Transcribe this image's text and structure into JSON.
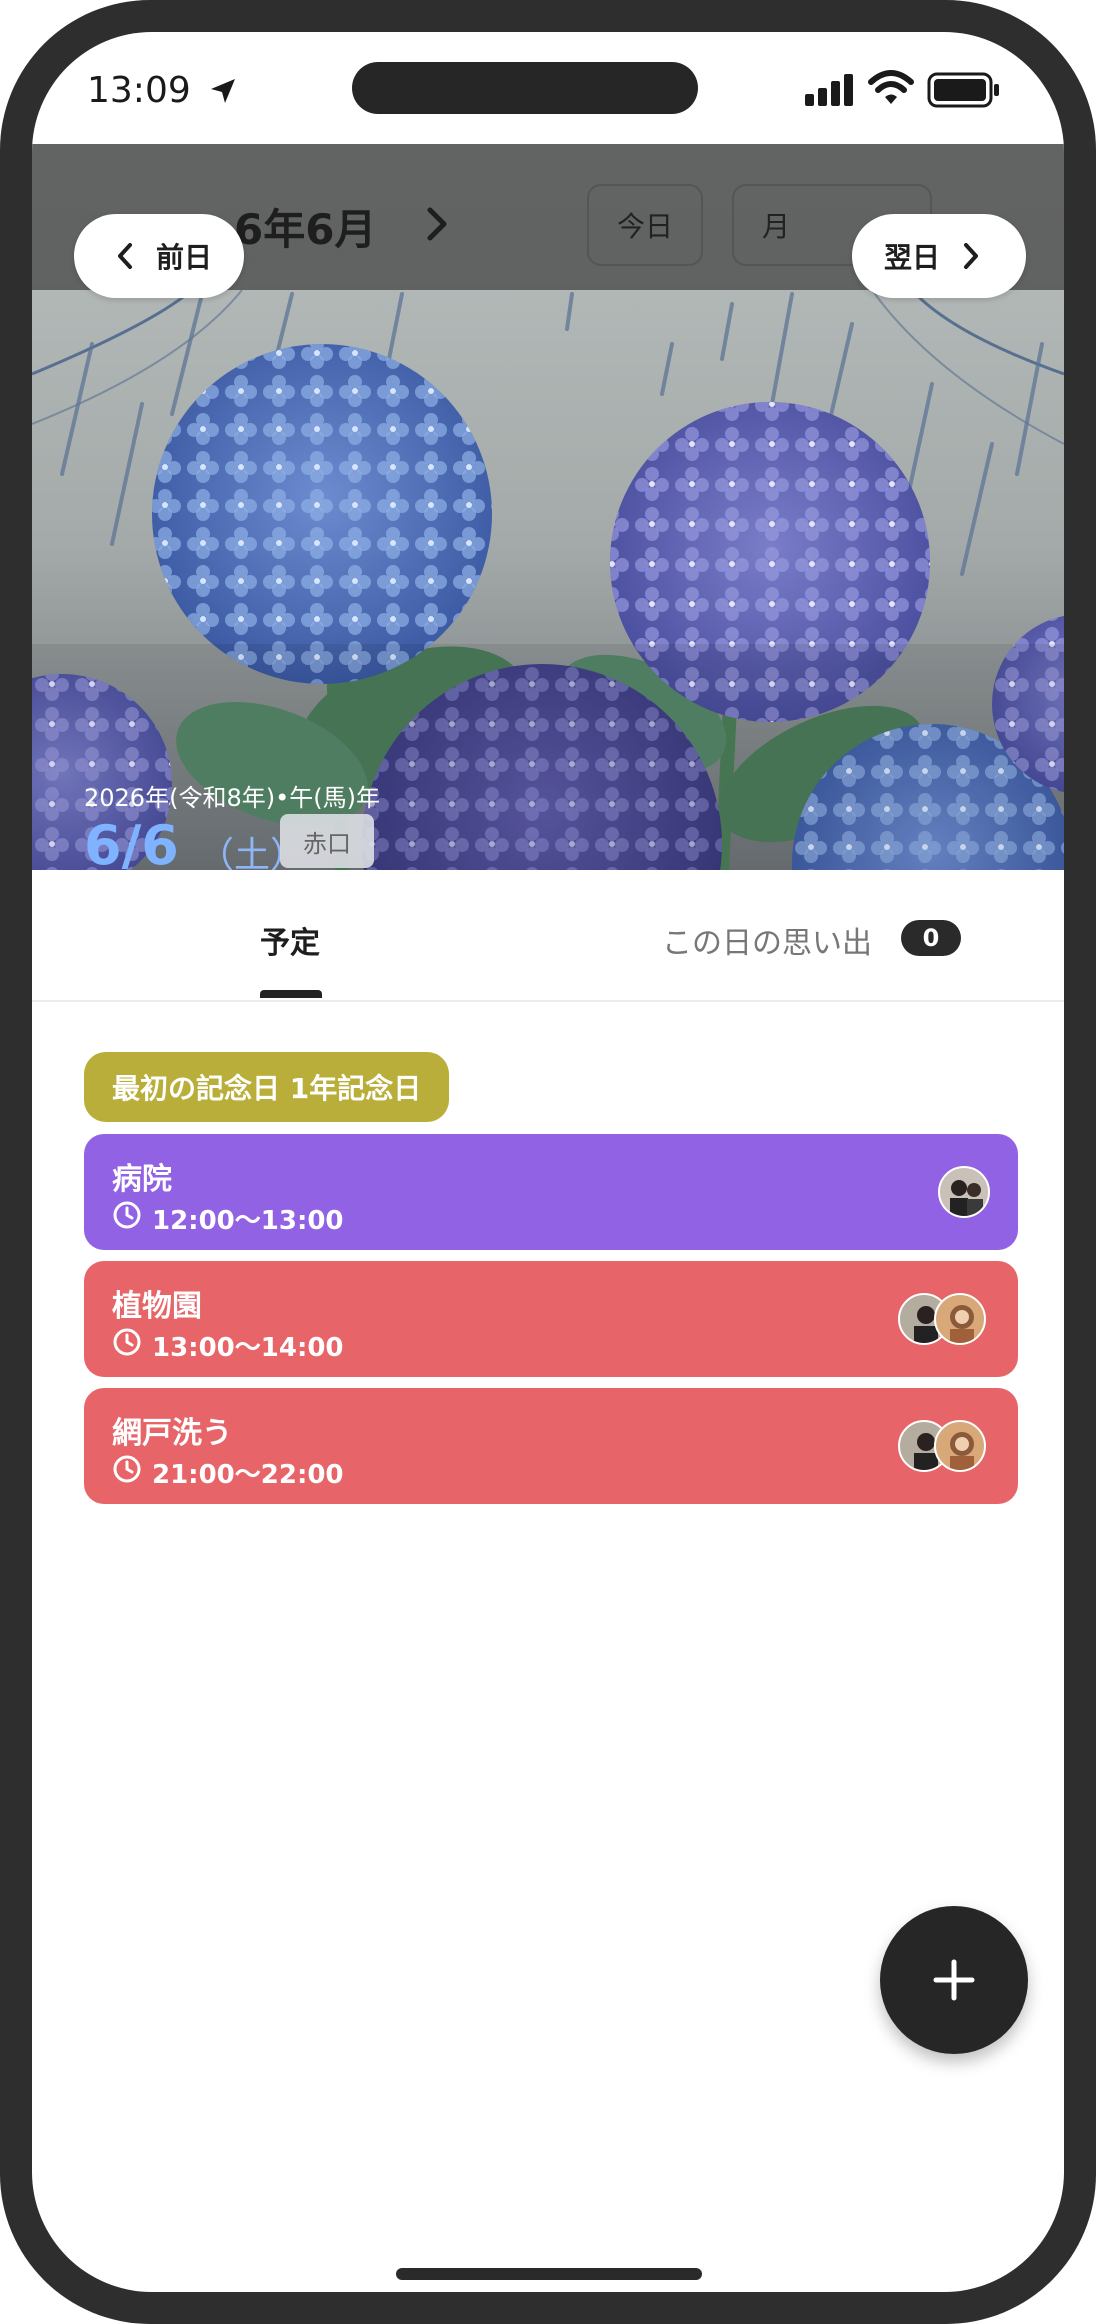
{
  "status_bar": {
    "time": "13:09"
  },
  "header": {
    "month_title": "6年6月",
    "prev_label": "前日",
    "next_label": "翌日",
    "today_label": "今日",
    "view_label": "月"
  },
  "date_info": {
    "era": "2026年(令和8年)•午(馬)年",
    "date": "6/6",
    "weekday": "（土）",
    "rokuyo": "赤口"
  },
  "tabs": {
    "plan": "予定",
    "memories": "この日の思い出",
    "memories_count": "0"
  },
  "anniversary": "最初の記念日 1年記念日",
  "events": [
    {
      "title": "病院",
      "time": "12:00〜13:00",
      "color": "#9162e4"
    },
    {
      "title": "植物園",
      "time": "13:00〜14:00",
      "color": "#e76468"
    },
    {
      "title": "網戸洗う",
      "time": "21:00〜22:00",
      "color": "#e76468"
    }
  ],
  "icons": [
    "location-arrow-icon",
    "signal-icon",
    "wifi-icon",
    "battery-icon",
    "chevron-left-icon",
    "chevron-right-icon",
    "clock-icon",
    "plus-icon"
  ]
}
